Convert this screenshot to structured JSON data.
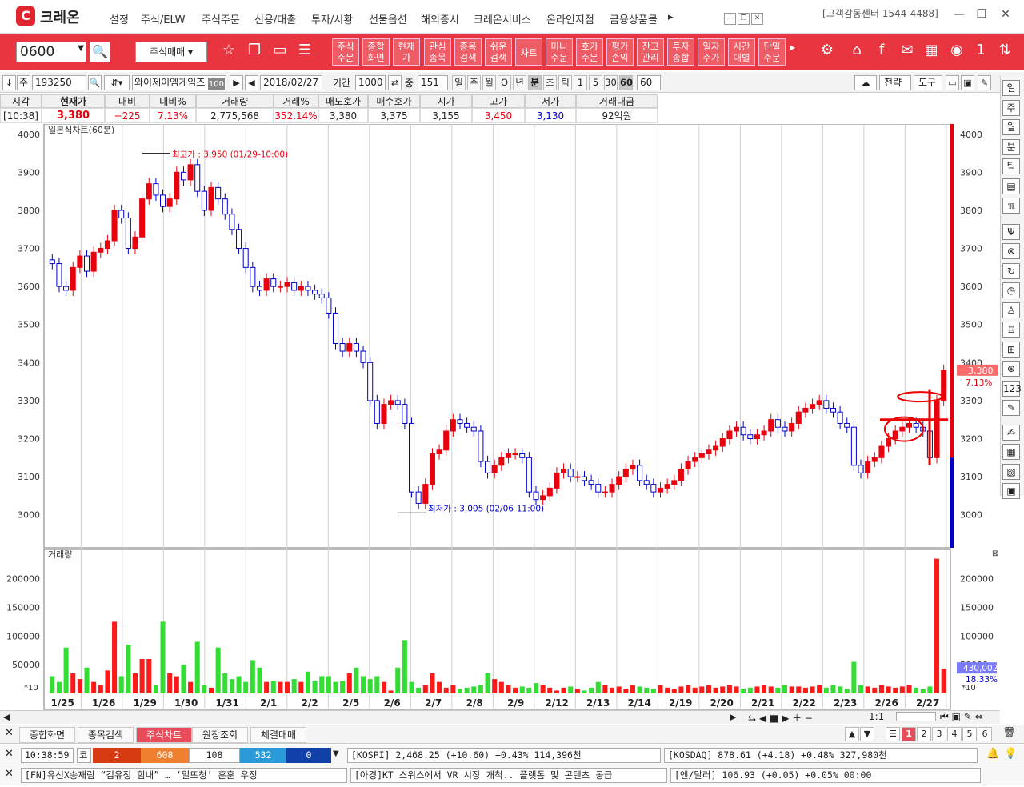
{
  "app": {
    "logo_letter": "C",
    "logo_text": "크레온"
  },
  "menu": [
    "설정",
    "주식/ELW",
    "주식주문",
    "신용/대출",
    "투자/시황",
    "선물옵션",
    "해외증시",
    "크레온서비스",
    "온라인지점",
    "금융상품몰"
  ],
  "menu_more": "▸",
  "customer_center": "[고객감동센터 1544-4488]",
  "toolbar": {
    "code": "0600",
    "mode": "주식매매",
    "buttons": [
      "주식\n주문",
      "종합\n화면",
      "현재\n가",
      "관심\n종목",
      "종목\n검색",
      "쉬운\n검색",
      "차트",
      "미니\n주문",
      "호가\n주문",
      "평가\n손익",
      "잔고\n관리",
      "투자\n종합",
      "일자\n주가",
      "시간\n대별",
      "단일\n주문"
    ]
  },
  "row3": {
    "market": "주",
    "code": "193250",
    "name": "와이제이엠게임즈",
    "name_badge": "100",
    "date": "2018/02/27",
    "period_label": "기간",
    "period_value": "1000",
    "mid_label": "중",
    "mid_value": "151",
    "periods": [
      "일",
      "주",
      "월",
      "Q",
      "년",
      "분",
      "초",
      "틱",
      "1",
      "5",
      "30",
      "60"
    ],
    "selected_period": "분",
    "selected_min": "60",
    "min_combo": "60",
    "strategy": "전략",
    "tools": "도구"
  },
  "quote": {
    "headers": [
      "시각",
      "현재가",
      "대비",
      "대비%",
      "거래량",
      "거래%",
      "매도호가",
      "매수호가",
      "시가",
      "고가",
      "저가",
      "거래대금"
    ],
    "values": [
      "[10:38]",
      "3,380",
      "+225",
      "7.13%",
      "2,775,568",
      "352.14%",
      "3,380",
      "3,375",
      "3,155",
      "3,450",
      "3,130",
      "92억원"
    ]
  },
  "chart_data": {
    "type": "candlestick",
    "title": "일본식차트(60분)",
    "volume_title": "거래량",
    "y_ticks": [
      3000,
      3100,
      3200,
      3300,
      3400,
      3500,
      3600,
      3700,
      3800,
      3900,
      4000
    ],
    "vol_ticks": [
      "200000",
      "150000",
      "100000",
      "50000"
    ],
    "vol_unit": "*10",
    "x_labels": [
      "1/25",
      "1/26",
      "1/29",
      "1/30",
      "1/31",
      "2/1",
      "2/2",
      "2/5",
      "2/6",
      "2/7",
      "2/8",
      "2/9",
      "2/12",
      "2/13",
      "2/14",
      "2/19",
      "2/20",
      "2/21",
      "2/22",
      "2/23",
      "2/26",
      "2/27"
    ],
    "high_note": "최고가 : 3,950 (01/29-10:00)",
    "low_note": "최저가 : 3,005 (02/06-11:00)",
    "last_price": "3,380",
    "last_change": "7.13%",
    "last_volume": "430,002",
    "last_volume_pct": "18.33%",
    "closes": [
      3660,
      3600,
      3590,
      3650,
      3680,
      3640,
      3690,
      3700,
      3720,
      3800,
      3780,
      3700,
      3730,
      3830,
      3870,
      3840,
      3810,
      3830,
      3900,
      3880,
      3920,
      3850,
      3800,
      3860,
      3830,
      3790,
      3750,
      3700,
      3650,
      3600,
      3590,
      3620,
      3600,
      3600,
      3610,
      3590,
      3600,
      3590,
      3580,
      3570,
      3530,
      3450,
      3430,
      3450,
      3430,
      3400,
      3300,
      3240,
      3290,
      3300,
      3290,
      3240,
      3060,
      3030,
      3080,
      3160,
      3170,
      3220,
      3250,
      3240,
      3230,
      3220,
      3140,
      3110,
      3130,
      3150,
      3160,
      3160,
      3150,
      3060,
      3040,
      3050,
      3070,
      3110,
      3120,
      3100,
      3100,
      3090,
      3080,
      3060,
      3060,
      3080,
      3100,
      3120,
      3130,
      3090,
      3080,
      3060,
      3070,
      3080,
      3090,
      3120,
      3140,
      3150,
      3160,
      3170,
      3180,
      3200,
      3220,
      3230,
      3210,
      3200,
      3210,
      3220,
      3250,
      3230,
      3220,
      3240,
      3270,
      3280,
      3290,
      3300,
      3280,
      3270,
      3240,
      3230,
      3130,
      3110,
      3140,
      3150,
      3180,
      3200,
      3220,
      3230,
      3240,
      3230,
      3220,
      3150,
      3300,
      3380
    ],
    "volumes": [
      30000,
      20000,
      80000,
      35000,
      25000,
      45000,
      20000,
      15000,
      40000,
      125000,
      30000,
      85000,
      35000,
      60000,
      60000,
      15000,
      125000,
      35000,
      30000,
      50000,
      20000,
      90000,
      15000,
      10000,
      80000,
      35000,
      25000,
      30000,
      20000,
      58000,
      45000,
      20000,
      22000,
      20000,
      20000,
      25000,
      20000,
      38000,
      22000,
      30000,
      30000,
      20000,
      22000,
      35000,
      45000,
      30000,
      25000,
      30000,
      20000,
      5000,
      45000,
      93000,
      20000,
      10000,
      15000,
      35000,
      20000,
      10000,
      15000,
      8000,
      10000,
      12000,
      15000,
      35000,
      25000,
      20000,
      15000,
      10000,
      12000,
      10000,
      18000,
      15000,
      10000,
      5000,
      10000,
      12000,
      8000,
      5000,
      10000,
      20000,
      15000,
      10000,
      12000,
      8000,
      15000,
      12000,
      10000,
      8000,
      15000,
      10000,
      8000,
      12000,
      15000,
      10000,
      12000,
      15000,
      10000,
      12000,
      15000,
      12000,
      8000,
      10000,
      12000,
      15000,
      12000,
      10000,
      15000,
      12000,
      12000,
      10000,
      12000,
      15000,
      10000,
      15000,
      12000,
      8000,
      55000,
      15000,
      12000,
      10000,
      15000,
      12000,
      10000,
      12000,
      15000,
      10000,
      8000,
      12000,
      235000,
      43000
    ]
  },
  "right_panel": [
    "일",
    "주",
    "월",
    "분",
    "틱",
    "▤",
    "ℼ",
    "Ψ",
    "⊗",
    "↻",
    "◷",
    "♙",
    "♖",
    "⊞",
    "⊕",
    "123",
    "✎",
    "✍",
    "▦",
    "▧",
    "▣"
  ],
  "scroll": {
    "zoom": "1:1"
  },
  "bottom_tabs": [
    "종합화면",
    "종목검색",
    "주식차트",
    "원장조회",
    "체결매매"
  ],
  "active_tab": "주식차트",
  "pages": [
    "1",
    "2",
    "3",
    "4",
    "5",
    "6"
  ],
  "status1": {
    "time": "10:38:59",
    "market": "코",
    "up": "2",
    "up2": "608",
    "flat": "108",
    "down": "532",
    "down2": "0",
    "kospi": "[KOSPI] 2,468.25 (+10.60) +0.43% 114,396천",
    "kosdaq": "[KOSDAQ] 878.61 (+4.18) +0.48% 327,980천"
  },
  "status2": {
    "news1": "[FN]유선X송재림 “김유정 힘내” … ‘일뜨청’ 훈훈 우정",
    "news2": "[아경]KT 스위스에서 VR 시장 개척.. 플랫폼 및 콘텐츠 공급",
    "fx": "[엔/달러] 106.93 (+0.05) +0.05% 00:00"
  },
  "colors": {
    "accent": "#e8353f",
    "up": "#e8000d",
    "down": "#0000cc",
    "vol_up": "#ff1a1a",
    "vol_down": "#33dd33"
  }
}
